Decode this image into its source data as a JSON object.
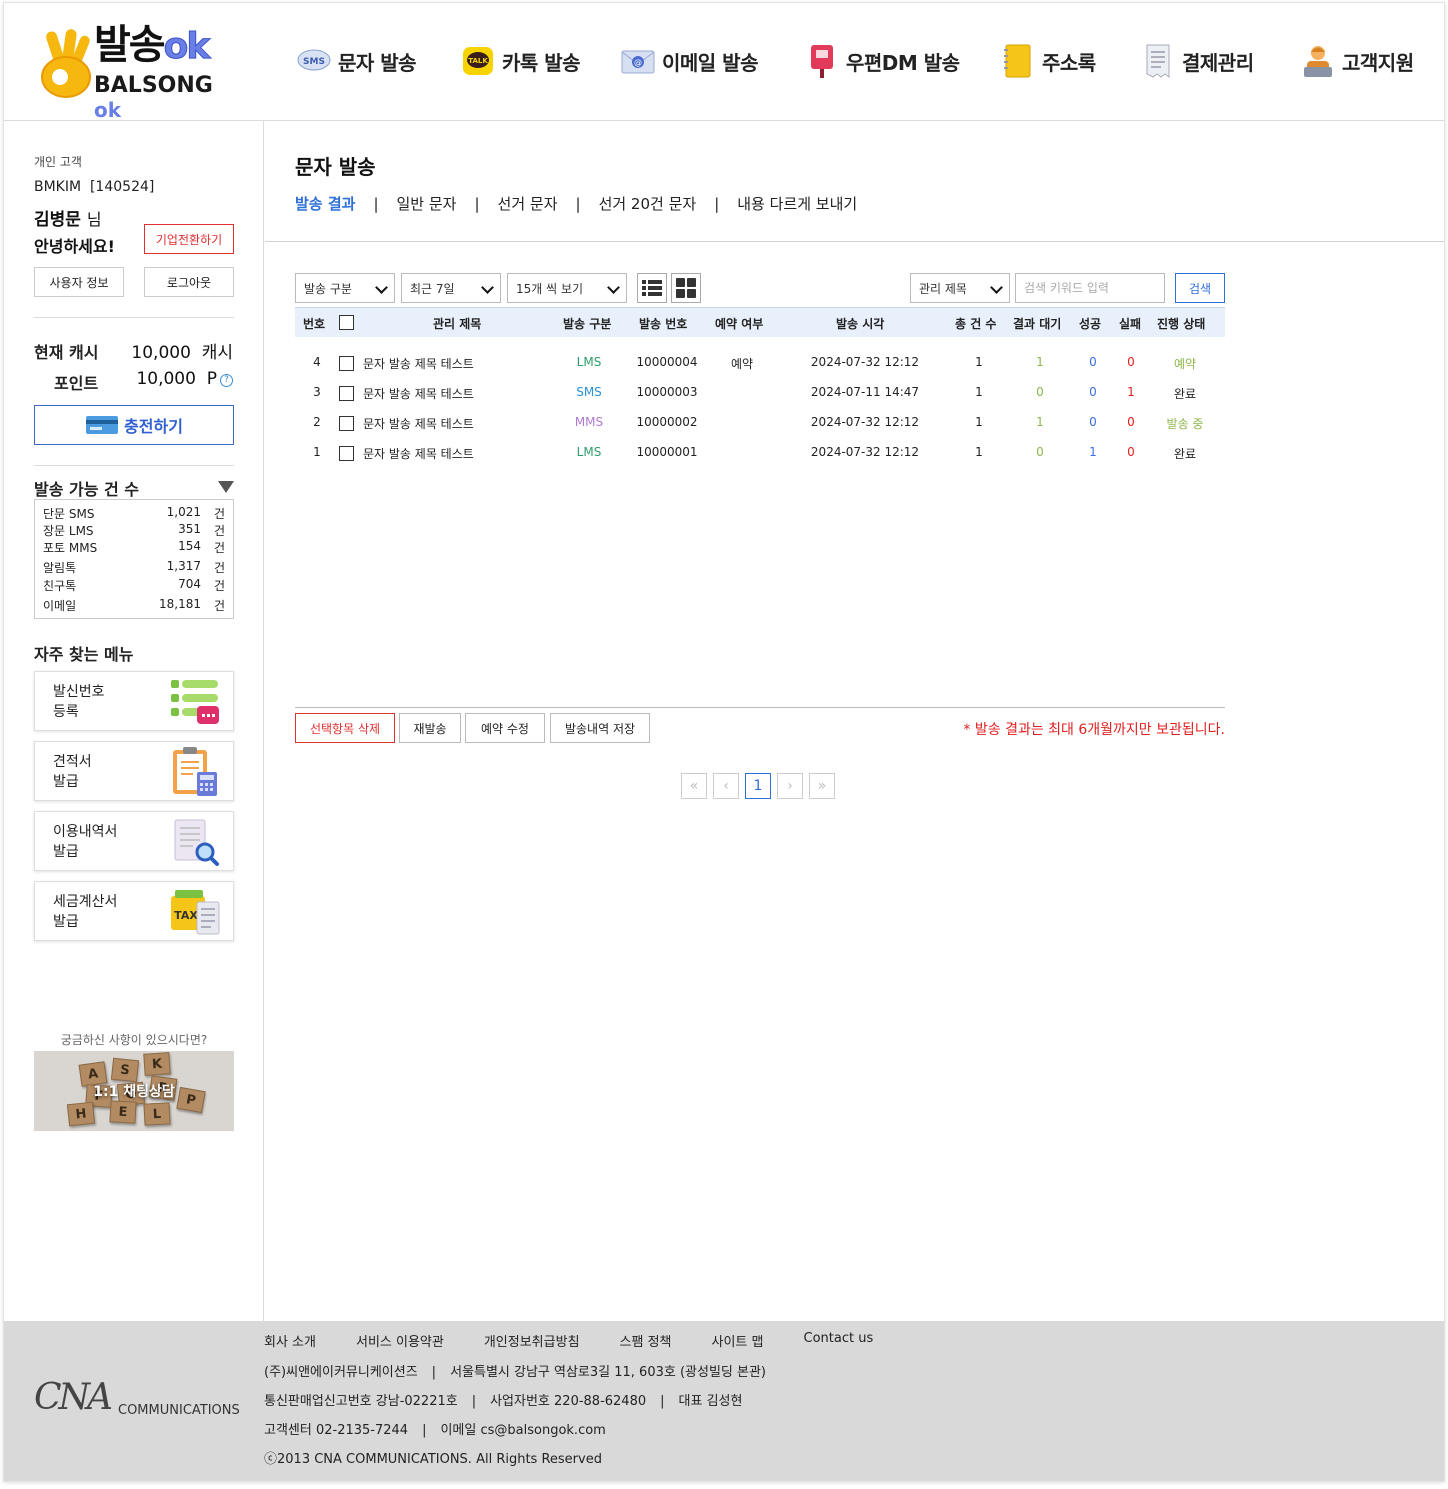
{
  "logo": {
    "main": "발송",
    "main_ok": "ok",
    "sub": "BALSONG",
    "sub_ok": "ok"
  },
  "nav": [
    {
      "label": "문자 발송",
      "icon": "sms-bubble-icon"
    },
    {
      "label": "카톡 발송",
      "icon": "kakao-talk-icon"
    },
    {
      "label": "이메일 발송",
      "icon": "email-envelope-icon"
    },
    {
      "label": "우편DM 발송",
      "icon": "mailbox-icon"
    },
    {
      "label": "주소록",
      "icon": "address-book-icon"
    },
    {
      "label": "결제관리",
      "icon": "receipt-icon"
    },
    {
      "label": "고객지원",
      "icon": "support-agent-icon"
    }
  ],
  "sidebar": {
    "customer_type": "개인 고객",
    "user_id": "BMKIM  [140524]",
    "user_name": "김병문",
    "honorific": "님",
    "greeting": "안녕하세요!",
    "corp_switch": "기업전환하기",
    "user_info": "사용자 정보",
    "logout": "로그아웃",
    "cash_label": "현재 캐시",
    "cash_value": "10,000  캐시",
    "point_label": "포인트",
    "point_value": "10,000  P",
    "charge": "충전하기",
    "avail_title": "발송 가능 건 수",
    "avail": [
      {
        "name": "단문 SMS",
        "value": "1,021",
        "unit": "건"
      },
      {
        "name": "장문 LMS",
        "value": "351",
        "unit": "건"
      },
      {
        "name": "포토 MMS",
        "value": "154",
        "unit": "건"
      },
      {
        "name": "알림톡",
        "value": "1,317",
        "unit": "건"
      },
      {
        "name": "친구톡",
        "value": "704",
        "unit": "건"
      },
      {
        "name": "이메일",
        "value": "18,181",
        "unit": "건"
      }
    ],
    "fav_title": "자주 찾는 메뉴",
    "fav": [
      {
        "label": "발신번호\n등록"
      },
      {
        "label": "견적서\n발급"
      },
      {
        "label": "이용내역서\n발급"
      },
      {
        "label": "세금계산서\n발급"
      }
    ],
    "ask_question": "궁금하신 사항이 있으시다면?",
    "ask_label": "1:1 채팅상담",
    "ask_tiles": [
      "A",
      "S",
      "K",
      "F",
      "O",
      "R",
      "H",
      "E",
      "L",
      "P"
    ]
  },
  "main": {
    "title": "문자 발송",
    "tabs": [
      "발송 결과",
      "일반 문자",
      "선거 문자",
      "선거 20건 문자",
      "내용 다르게 보내기"
    ],
    "tab_sep": "|",
    "filter_type": "발송 구분",
    "filter_period": "최근 7일",
    "filter_pagesize": "15개 씩 보기",
    "search_field": "관리 제목",
    "search_placeholder": "검색 키워드 입력",
    "search_button": "검색",
    "columns": [
      "번호",
      "관리 제목",
      "발송 구분",
      "발송 번호",
      "예약 여부",
      "발송 시각",
      "총 건 수",
      "결과 대기",
      "성공",
      "실패",
      "진행 상태"
    ],
    "rows": [
      {
        "no": "4",
        "title": "문자 발송 제목 테스트",
        "type": "LMS",
        "type_class": "c-lms",
        "send_no": "10000004",
        "reserve": "예약",
        "time": "2024-07-32 12:12",
        "total": "1",
        "wait": "1",
        "success": "0",
        "fail": "0",
        "status": "예약",
        "status_class": "c-reserve"
      },
      {
        "no": "3",
        "title": "문자 발송 제목 테스트",
        "type": "SMS",
        "type_class": "c-sms",
        "send_no": "10000003",
        "reserve": "",
        "time": "2024-07-11 14:47",
        "total": "1",
        "wait": "0",
        "success": "0",
        "fail": "1",
        "status": "완료",
        "status_class": "c-done"
      },
      {
        "no": "2",
        "title": "문자 발송 제목 테스트",
        "type": "MMS",
        "type_class": "c-mms",
        "send_no": "10000002",
        "reserve": "",
        "time": "2024-07-32 12:12",
        "total": "1",
        "wait": "1",
        "success": "0",
        "fail": "0",
        "status": "발송 중",
        "status_class": "c-sending"
      },
      {
        "no": "1",
        "title": "문자 발송 제목 테스트",
        "type": "LMS",
        "type_class": "c-lms",
        "send_no": "10000001",
        "reserve": "",
        "time": "2024-07-32 12:12",
        "total": "1",
        "wait": "0",
        "success": "1",
        "fail": "0",
        "status": "완료",
        "status_class": "c-done"
      }
    ],
    "actions": [
      "선택항목 삭제",
      "재발송",
      "예약 수정",
      "발송내역 저장"
    ],
    "notice": "* 발송 결과는 최대 6개월까지만 보관됩니다.",
    "pager": {
      "first": "«",
      "prev": "‹",
      "current": "1",
      "next": "›",
      "last": "»"
    }
  },
  "footer": {
    "links": [
      "회사 소개",
      "서비스 이용약관",
      "개인정보취급방침",
      "스팸 정책",
      "사이트 맵",
      "Contact us"
    ],
    "logo_big": "CNA",
    "logo_small": "COMMUNICATIONS",
    "company": "(주)씨앤에이커뮤니케이션즈",
    "address": "서울특별시 강남구 역삼로3길 11, 603호 (광성빌딩 본관)",
    "mail_order": "통신판매업신고번호 강남-02221호",
    "biz_no": "사업자번호 220-88-62480",
    "ceo": "대표 김성현",
    "cs_center": "고객센터 02-2135-7244",
    "email": "이메일 cs@balsongok.com",
    "copyright": "ⓒ2013 CNA COMMUNICATIONS. All Rights Reserved",
    "bar": "|"
  }
}
